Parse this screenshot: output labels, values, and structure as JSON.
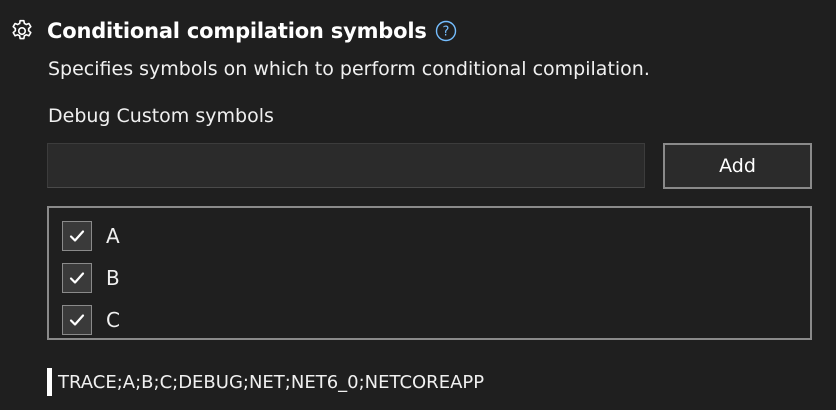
{
  "section": {
    "title": "Conditional compilation symbols",
    "description": "Specifies symbols on which to perform conditional compilation.",
    "field_label": "Debug Custom symbols",
    "input": {
      "value": "",
      "placeholder": ""
    },
    "add_button_label": "Add",
    "symbols": [
      {
        "label": "A",
        "checked": true
      },
      {
        "label": "B",
        "checked": true
      },
      {
        "label": "C",
        "checked": true
      }
    ],
    "resulting_symbols": "TRACE;A;B;C;DEBUG;NET;NET6_0;NETCOREAPP"
  },
  "icons": {
    "settings": "gear-icon",
    "help": "help-icon",
    "check": "checkmark-icon"
  },
  "colors": {
    "background": "#1f1f1f",
    "help_accent": "#75beff",
    "border": "#8a8a8a"
  }
}
